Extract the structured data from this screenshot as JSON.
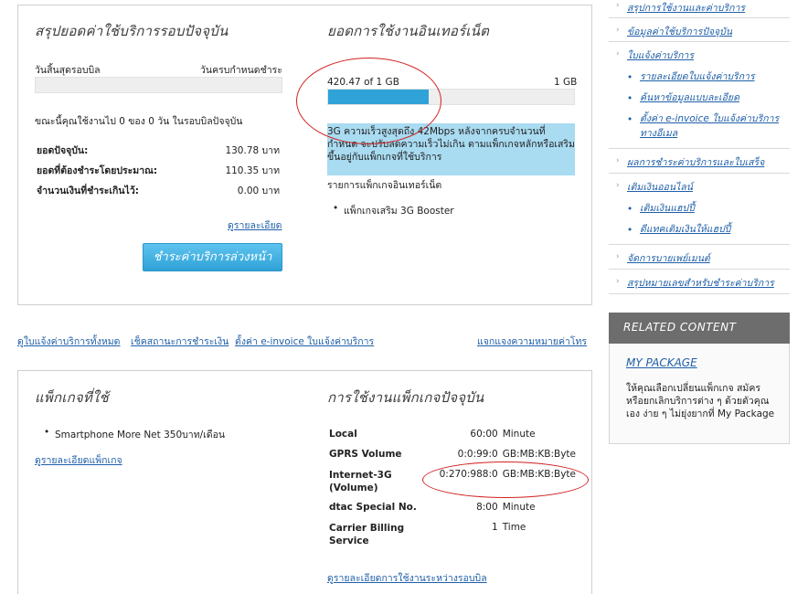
{
  "summary": {
    "title": "สรุปยอดค่าใช้บริการรอบปัจจุบัน",
    "cycle_end_label": "วันสิ้นสุดรอบบิล",
    "due_date_label": "วันครบกำหนดชำระ",
    "usage_note": "ขณะนี้คุณใช้งานไป 0 ของ 0 วัน ในรอบบิลปัจจุบัน",
    "rows": [
      {
        "label": "ยอดปัจจุบัน:",
        "value": "130.78 บาท"
      },
      {
        "label": "ยอดที่ต้องชำระโดยประมาณ:",
        "value": "110.35 บาท"
      },
      {
        "label": "จำนวนเงินที่ชำระเกินไว้:",
        "value": "0.00 บาท"
      }
    ],
    "details_link": "ดูรายละเอียด",
    "prepay_button": "ชำระค่าบริการล่วงหน้า"
  },
  "internet": {
    "title": "ยอดการใช้งานอินเทอร์เน็ต",
    "usage_text": "420.47 of 1 GB",
    "limit_text": "1 GB",
    "usage_fraction": 0.41,
    "description": "3G ความเร็วสูงสุดถึง 42Mbps หลังจากครบจำนวนที่กำหนด จะปรับลดความเร็วไม่เกิน ตามแพ็กเกจหลักหรือเสริม ขึ้นอยู่กับแพ็กเกจที่ใช้บริการ",
    "package_list_label": "รายการแพ็กเกจอินเทอร์เน็ต",
    "packages": [
      "แพ็กเกจเสริม 3G Booster"
    ]
  },
  "links_row": {
    "all_bills": "ดูใบแจ้งค่าบริการทั้งหมด",
    "payment_status": "เช็คสถานะการชำระเงิน",
    "einvoice": "ตั้งค่า e-invoice ใบแจ้งค่าบริการ",
    "call_meaning": "แจกแจงความหมายค่าโทร"
  },
  "package": {
    "title": "แพ็กเกจที่ใช้",
    "items": [
      "Smartphone More Net 350บาท/เดือน"
    ],
    "details_link": "ดูรายละเอียดแพ็กเกจ"
  },
  "current_usage": {
    "title": "การใช้งานแพ็กเกจปัจจุบัน",
    "rows": [
      {
        "label": "Local",
        "value": "60:00",
        "unit": "Minute"
      },
      {
        "label": "GPRS Volume",
        "value": "0:0:99:0",
        "unit": "GB:MB:KB:Byte"
      },
      {
        "label": "Internet-3G (Volume)",
        "value": "0:270:988:0",
        "unit": "GB:MB:KB:Byte"
      },
      {
        "label": "dtac Special No.",
        "value": "8:00",
        "unit": "Minute"
      },
      {
        "label": "Carrier Billing Service",
        "value": "1",
        "unit": "Time"
      }
    ],
    "details_link": "ดูรายละเอียดการใช้งานระหว่างรอบบิล"
  },
  "sidebar": {
    "items": [
      {
        "label": "สรุปการใช้งานและค่าบริการ",
        "subs": []
      },
      {
        "label": "ข้อมูลค่าใช้บริการปัจจุบัน",
        "subs": []
      },
      {
        "label": "ใบแจ้งค่าบริการ",
        "subs": [
          "รายละเอียดใบแจ้งค่าบริการ",
          "ค้นหาข้อมูลแบบละเอียด",
          "ตั้งค่า e-invoice ใบแจ้งค่าบริการทางอีเมล"
        ]
      },
      {
        "label": "ผลการชำระค่าบริการและใบเสร็จ",
        "subs": []
      },
      {
        "label": "เติมเงินออนไลน์",
        "subs": [
          "เติมเงินแฮปปี้",
          "ดีแทคเติมเงินให้แฮปปี้"
        ]
      },
      {
        "label": "จัดการบายเพย์เมนต์",
        "subs": []
      },
      {
        "label": "สรุปหมายเลขสำหรับชำระค่าบริการ",
        "subs": []
      }
    ]
  },
  "related": {
    "header": "RELATED CONTENT",
    "link": "MY PACKAGE",
    "text": "ให้คุณเลือกเปลี่ยนแพ็กเกจ สมัคร หรือยกเลิกบริการต่าง ๆ ด้วยตัวคุณเอง ง่าย ๆ ไม่ยุ่งยากที่ My Package"
  },
  "colors": {
    "accent_blue": "#2fa2d8",
    "link_blue": "#1f5fa8",
    "highlight": "#a9dbf1",
    "annotation_red": "#d11f1f"
  }
}
